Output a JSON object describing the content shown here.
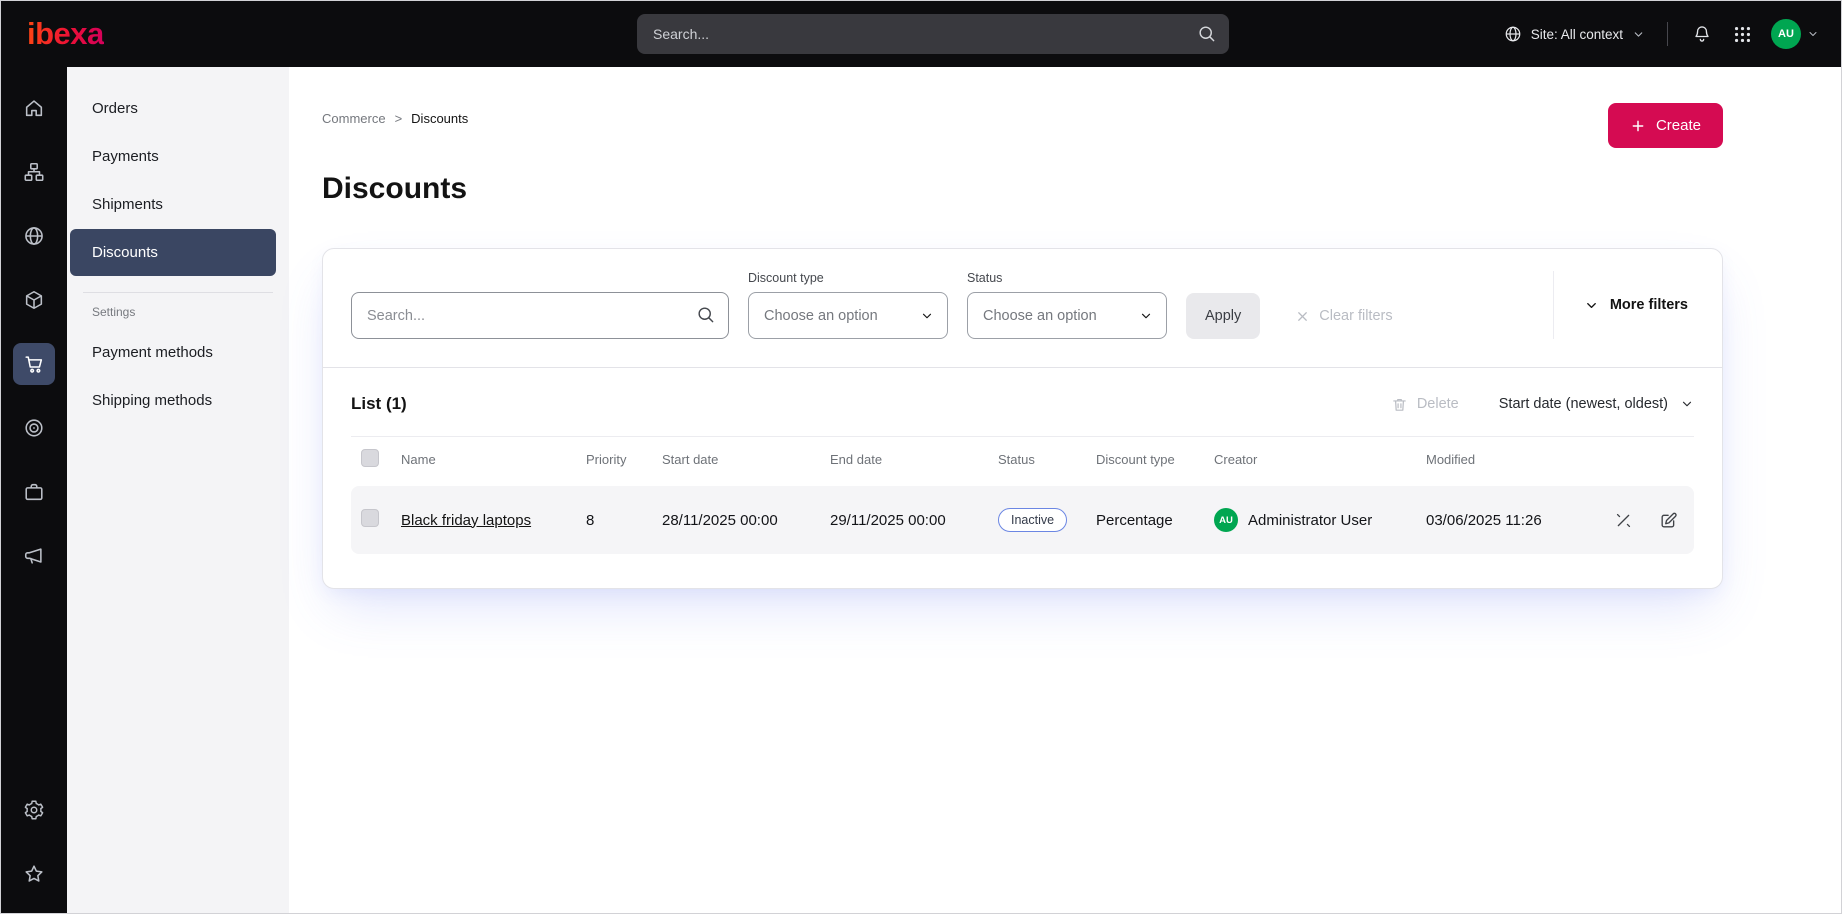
{
  "topbar": {
    "logo_text": "ibexa",
    "search_placeholder": "Search...",
    "site_context_label": "Site: All context",
    "avatar_initials": "AU"
  },
  "icon_rail": {
    "items": [
      "home",
      "content-tree",
      "site",
      "product-catalog",
      "commerce",
      "personalization",
      "workflow",
      "marketing"
    ],
    "bottom_items": [
      "settings",
      "bookmarks"
    ],
    "active_item": "commerce"
  },
  "sidebar": {
    "items": [
      {
        "label": "Orders",
        "active": false
      },
      {
        "label": "Payments",
        "active": false
      },
      {
        "label": "Shipments",
        "active": false
      },
      {
        "label": "Discounts",
        "active": true
      }
    ],
    "section_label": "Settings",
    "settings_items": [
      {
        "label": "Payment methods"
      },
      {
        "label": "Shipping methods"
      }
    ]
  },
  "breadcrumb": {
    "items": [
      "Commerce",
      "Discounts"
    ],
    "separator": ">"
  },
  "header": {
    "title": "Discounts",
    "create_label": "Create"
  },
  "filters": {
    "search_placeholder": "Search...",
    "discount_type_label": "Discount type",
    "discount_type_value": "Choose an option",
    "status_label": "Status",
    "status_value": "Choose an option",
    "apply_label": "Apply",
    "clear_label": "Clear filters",
    "more_filters_label": "More filters"
  },
  "list": {
    "title": "List (1)",
    "delete_label": "Delete",
    "sort_label": "Start date (newest, oldest)",
    "columns": [
      "Name",
      "Priority",
      "Start date",
      "End date",
      "Status",
      "Discount type",
      "Creator",
      "Modified"
    ],
    "rows": [
      {
        "name": "Black friday laptops",
        "priority": "8",
        "start_date": "28/11/2025 00:00",
        "end_date": "29/11/2025 00:00",
        "status": "Inactive",
        "discount_type": "Percentage",
        "creator": "Administrator User",
        "creator_initials": "AU",
        "modified": "03/06/2025 11:26"
      }
    ]
  },
  "colors": {
    "accent": "#d50b52",
    "topbar_bg": "#0c0c0e",
    "active_nav_bg": "#3a4662",
    "status_inactive_border": "#6b86e3",
    "avatar_bg": "#00a651"
  },
  "icons": {
    "search-icon": "magnifier",
    "globe-icon": "globe",
    "bell-icon": "notifications",
    "grid-icon": "app-switcher",
    "chevron-down-icon": "caret down",
    "plus-icon": "add",
    "trash-icon": "delete",
    "x-icon": "clear",
    "edit-icon": "pencil on square",
    "deactivate-icon": "diagonal slash with ticks"
  }
}
